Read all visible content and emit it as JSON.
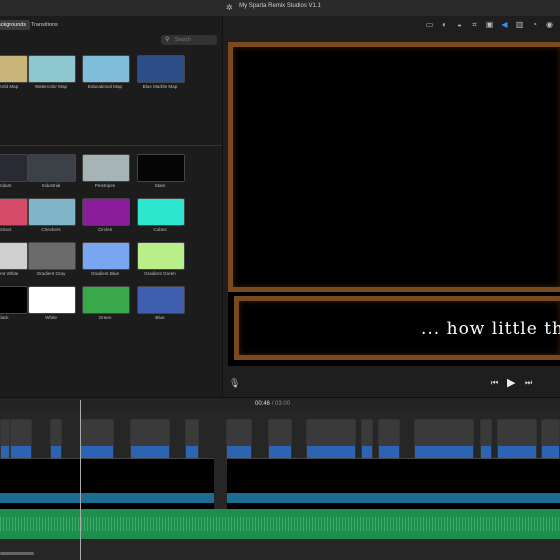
{
  "window": {
    "title": "My Sparta Remix Studios V1.1"
  },
  "browser": {
    "tabs": [
      "Backgrounds",
      "Transitions"
    ],
    "active_tab": "Backgrounds",
    "search_placeholder": "Search",
    "maps": [
      {
        "label": "Old World Map",
        "color": "#c9b47a"
      },
      {
        "label": "Watercolor Map",
        "color": "#8fc7d0"
      },
      {
        "label": "Educational Map",
        "color": "#7fbedb"
      },
      {
        "label": "Blue Marble Map",
        "color": "#2e4e8a"
      }
    ],
    "backgrounds": [
      {
        "label": "Pendant",
        "color": "#2a2a35"
      },
      {
        "label": "Industrial",
        "color": "#3b4147"
      },
      {
        "label": "Pinstripes",
        "color": "#a7b4b5"
      },
      {
        "label": "Stars",
        "color": "#050505"
      },
      {
        "label": "Abstract",
        "color": "#d64a6a"
      },
      {
        "label": "Checkers",
        "color": "#7fb4c9"
      },
      {
        "label": "Circles",
        "color": "#8a1e9a"
      },
      {
        "label": "Cubes",
        "color": "#2de6d0"
      },
      {
        "label": "Gradient White",
        "color": "#cfcfcf"
      },
      {
        "label": "Gradient Gray",
        "color": "#6b6b6b"
      },
      {
        "label": "Gradient Blue",
        "color": "#7aa6f0"
      },
      {
        "label": "Gradient Green",
        "color": "#b9ee8a"
      },
      {
        "label": "Black",
        "color": "#000000"
      },
      {
        "label": "White",
        "color": "#ffffff"
      },
      {
        "label": "Green",
        "color": "#38a84a"
      },
      {
        "label": "Blue",
        "color": "#3f5fae"
      }
    ]
  },
  "viewer": {
    "caption": "... how little they",
    "frame_color": "#7a4a1c"
  },
  "timeline": {
    "current_time": "00:46",
    "separator": "/",
    "total_time": "03:00"
  }
}
